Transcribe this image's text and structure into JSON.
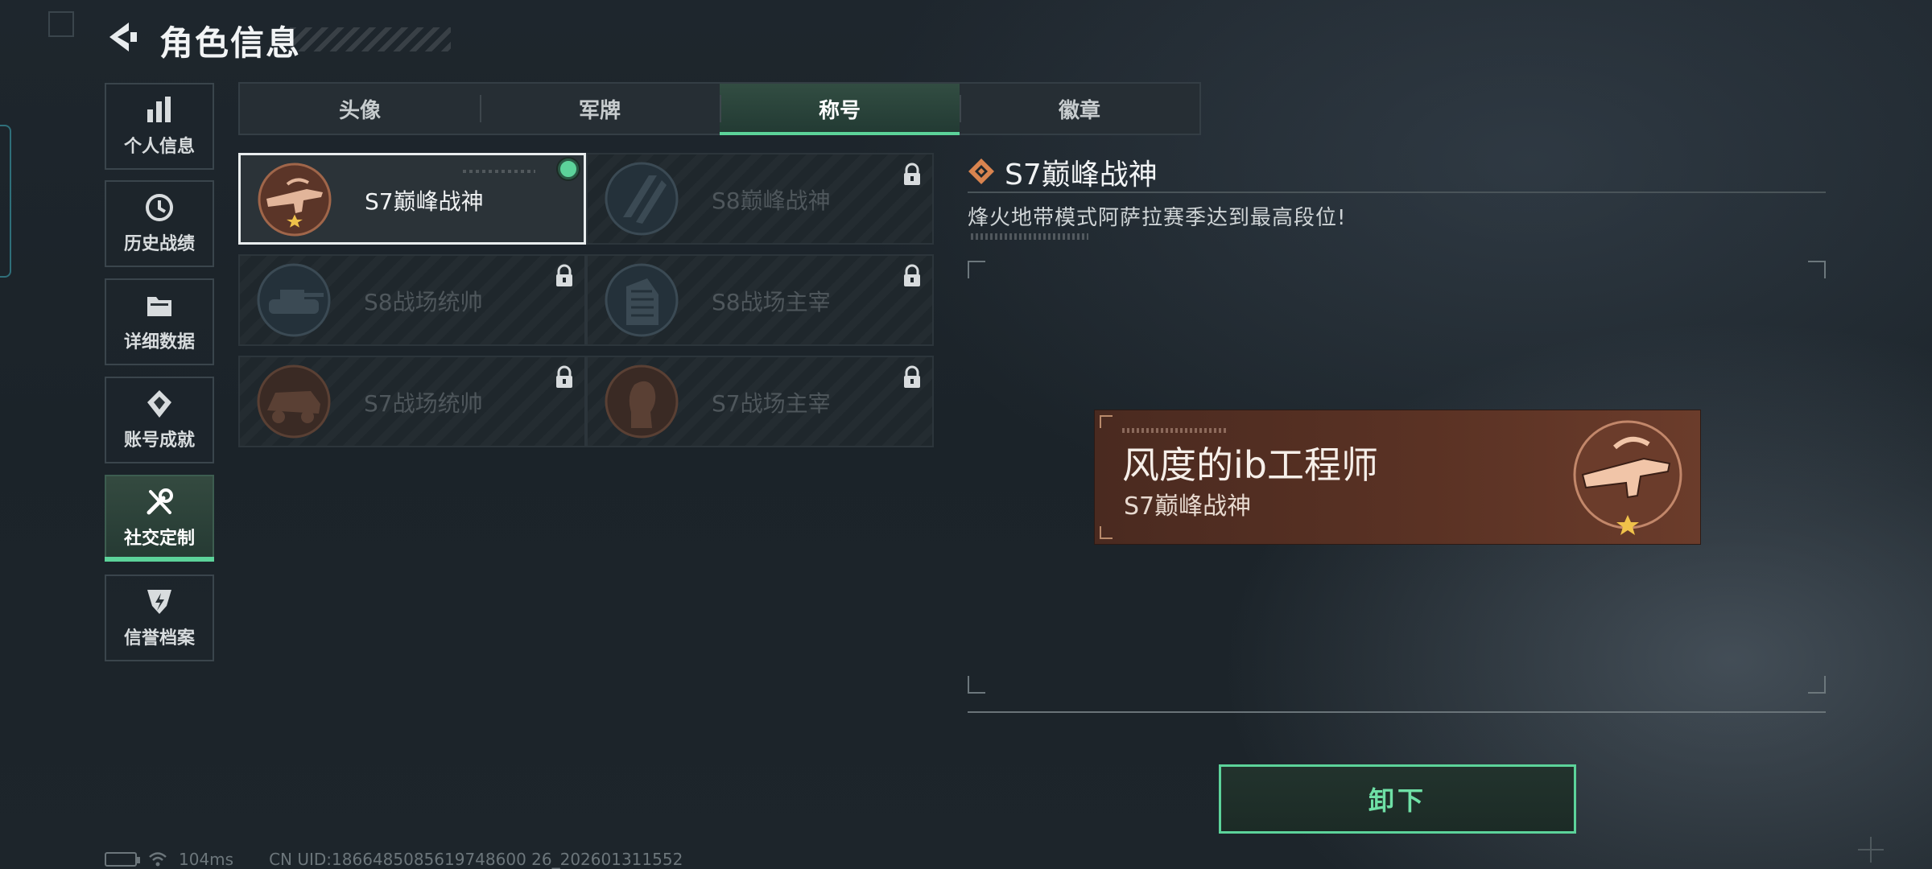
{
  "header": {
    "title": "角色信息"
  },
  "sidebar": {
    "items": [
      {
        "label": "个人信息",
        "icon": "bar-chart-icon"
      },
      {
        "label": "历史战绩",
        "icon": "history-clock-icon"
      },
      {
        "label": "详细数据",
        "icon": "folder-icon"
      },
      {
        "label": "账号成就",
        "icon": "achievement-icon"
      },
      {
        "label": "社交定制",
        "icon": "tools-icon",
        "active": true
      },
      {
        "label": "信誉档案",
        "icon": "reputation-icon"
      }
    ]
  },
  "tabs": [
    {
      "label": "头像"
    },
    {
      "label": "军牌"
    },
    {
      "label": "称号",
      "active": true
    },
    {
      "label": "徽章"
    }
  ],
  "titles": [
    {
      "name": "S7巅峰战神",
      "state": "equipped",
      "emblem": "rifle-emblem-icon"
    },
    {
      "name": "S8巅峰战神",
      "state": "locked",
      "emblem": "s8-stripes-emblem-icon"
    },
    {
      "name": "S8战场统帅",
      "state": "locked",
      "emblem": "tank-emblem-icon"
    },
    {
      "name": "S8战场主宰",
      "state": "locked",
      "emblem": "building-emblem-icon"
    },
    {
      "name": "S7战场统帅",
      "state": "locked",
      "emblem": "armored-vehicle-emblem-icon"
    },
    {
      "name": "S7战场主宰",
      "state": "locked",
      "emblem": "soldier-bust-emblem-icon"
    }
  ],
  "detail": {
    "title": "S7巅峰战神",
    "description": "烽火地带模式阿萨拉赛季达到最高段位!"
  },
  "nameplate": {
    "player_name": "风度的ib工程师",
    "title": "S7巅峰战神"
  },
  "action": {
    "unequip_label": "卸下"
  },
  "status": {
    "ping": "104ms",
    "uid": "CN UID:1866485085619748600 26_202601311552"
  },
  "colors": {
    "accent": "#5cd39a",
    "bronze": "#b77a5c",
    "plate": "#5a3224"
  }
}
